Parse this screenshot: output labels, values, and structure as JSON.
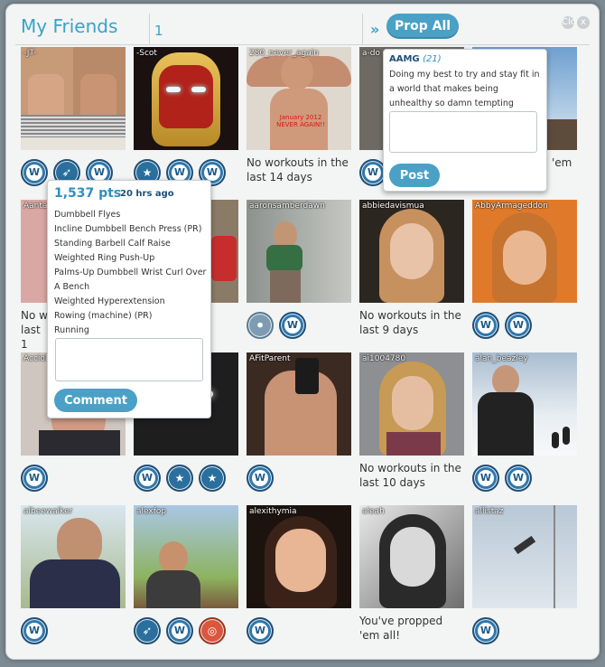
{
  "header": {
    "title": "My Friends",
    "page": "1",
    "next_icon": "»",
    "prop_all_label": "Prop All",
    "close_label": "Close",
    "close_icon": "x"
  },
  "friends": [
    {
      "name": "-JT-"
    },
    {
      "name": "-Scot"
    },
    {
      "name": "280_never_again"
    },
    {
      "name": "a-do"
    },
    {
      "name": ""
    },
    {
      "name": "Aanta"
    },
    {
      "name": ""
    },
    {
      "name": "aaronsamberdawn"
    },
    {
      "name": "abbiedavismua"
    },
    {
      "name": "AbbyArmageddon"
    },
    {
      "name": "Acciol"
    },
    {
      "name": ""
    },
    {
      "name": "AFitParent"
    },
    {
      "name": "ai1004780"
    },
    {
      "name": "alan_beazley"
    },
    {
      "name": "albeewalker"
    },
    {
      "name": "alexfop"
    },
    {
      "name": "alexithymia"
    },
    {
      "name": "aleah"
    },
    {
      "name": "allistaz"
    }
  ],
  "status_texts": {
    "r1c3": "No workouts in the last 14 days",
    "r1c5": "'em",
    "r2c1": "No w last 1",
    "r2c4": "No workouts in the last 9 days",
    "r3c4": "No workouts in the last 10 days",
    "r4c4": "You've propped 'em all!"
  },
  "photo_captions": {
    "r1c3_caption": "January 2012 NEVER AGAIN!!"
  },
  "workout_popup": {
    "points": "1,537 pts",
    "time": "20 hrs ago",
    "items": [
      "Dumbbell Flyes",
      "Incline Dumbbell Bench Press (PR)",
      "Standing Barbell Calf Raise",
      "Weighted Ring Push-Up",
      "Palms-Up Dumbbell Wrist Curl Over A Bench",
      "Weighted Hyperextension",
      "Rowing (machine) (PR)",
      "Running"
    ],
    "button_label": "Comment"
  },
  "status_popup": {
    "user": "AAMG",
    "count": "(21)",
    "message": "Doing my best to try and stay fit in a world that makes being unhealthy so damn tempting",
    "button_label": "Post"
  },
  "badge_glyphs": {
    "w": "W",
    "rocket": "➶",
    "star": "★",
    "orange": "◎",
    "bird": "⚫"
  }
}
